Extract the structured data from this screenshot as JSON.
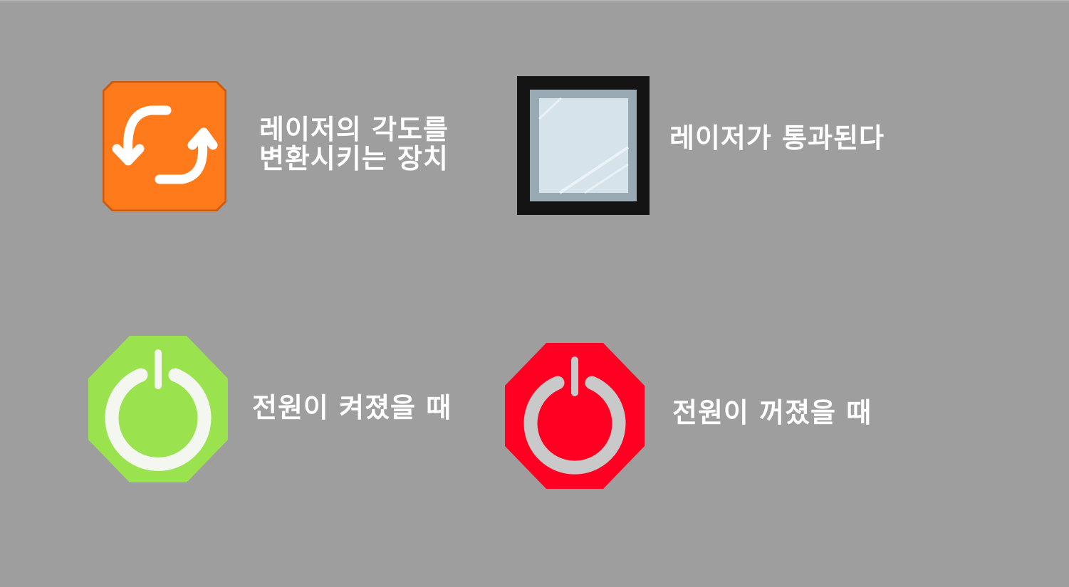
{
  "legend": {
    "rotator": {
      "icon": "rotate-arrows-icon",
      "color": "#ff7a1a",
      "label_lines": [
        "레이저의 각도를",
        "변환시키는 장치"
      ]
    },
    "glass": {
      "icon": "glass-window-icon",
      "color": "#d6e3eb",
      "label": "레이저가 통과된다"
    },
    "power_on": {
      "icon": "power-icon",
      "color": "#9be34e",
      "label": "전원이 켜졌을 때"
    },
    "power_off": {
      "icon": "power-icon",
      "color": "#ff0022",
      "label": "전원이 꺼졌을 때"
    }
  }
}
